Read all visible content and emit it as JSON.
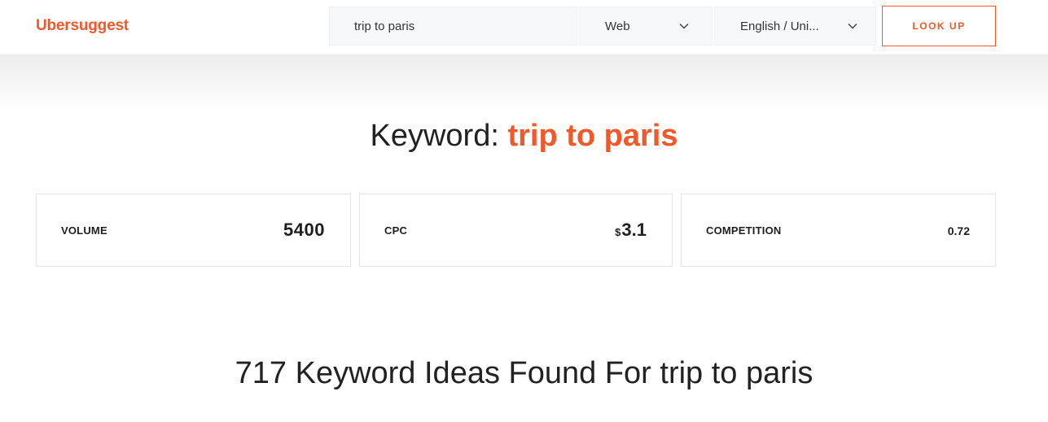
{
  "header": {
    "logo": "Ubersuggest",
    "search": {
      "value": "trip to paris"
    },
    "platform_select": {
      "selected": "Web",
      "icon": "chevron-down-icon"
    },
    "language_select": {
      "selected": "English / Uni...",
      "icon": "chevron-down-icon"
    },
    "lookup_button": "LOOK UP"
  },
  "keyword_overview": {
    "prefix": "Keyword:",
    "keyword": "trip to paris"
  },
  "metrics": {
    "volume": {
      "label": "VOLUME",
      "value": "5400"
    },
    "cpc": {
      "label": "CPC",
      "currency": "$",
      "value": "3.1"
    },
    "competition": {
      "label": "COMPETITION",
      "value": "0.72"
    }
  },
  "ideas_heading": "717 Keyword Ideas Found For trip to paris",
  "colors": {
    "accent": "#f1592a",
    "text": "#222222",
    "card_border": "#e4e4e4"
  }
}
